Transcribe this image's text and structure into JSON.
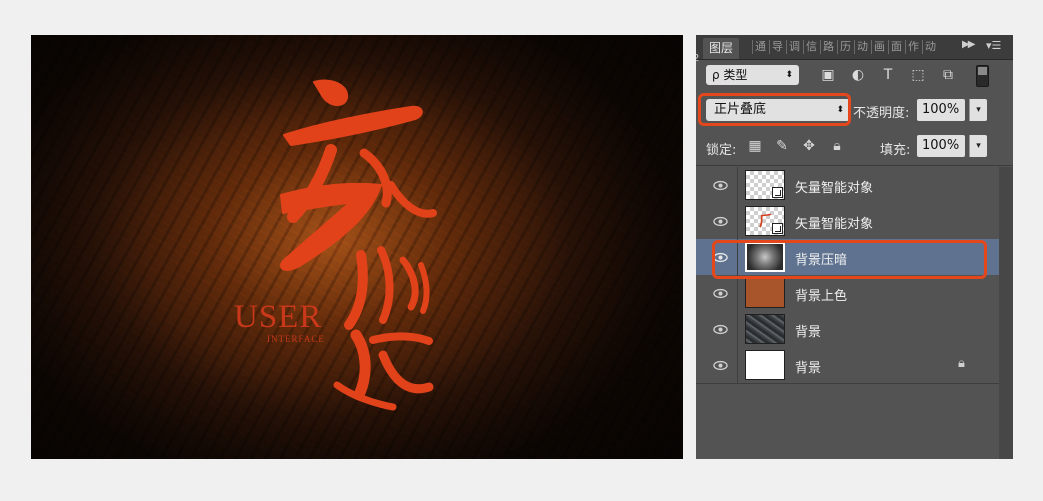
{
  "artwork": {
    "brand_text": "USER",
    "sub_text": "INTERFACE"
  },
  "layers_panel": {
    "tabs": [
      "图层",
      "通",
      "导",
      "调",
      "信",
      "路",
      "历",
      "动",
      "画",
      "面",
      "作",
      "动"
    ],
    "side_number": "2",
    "filter": {
      "label": "ρ 类型"
    },
    "blend_mode": "正片叠底",
    "opacity": {
      "label": "不透明度:",
      "value": "100%"
    },
    "lock": {
      "label": "锁定:"
    },
    "fill": {
      "label": "填充:",
      "value": "100%"
    },
    "layers": [
      {
        "name": "矢量智能对象",
        "thumb": "checker-smart",
        "visible": true,
        "selected": false
      },
      {
        "name": "矢量智能对象",
        "thumb": "checker-smart-mark",
        "visible": true,
        "selected": false
      },
      {
        "name": "背景压暗",
        "thumb": "dark-radial",
        "visible": true,
        "selected": true
      },
      {
        "name": "背景上色",
        "thumb": "brown",
        "visible": true,
        "selected": false
      },
      {
        "name": "背景",
        "thumb": "rock",
        "visible": true,
        "selected": false
      },
      {
        "name": "背景",
        "thumb": "white",
        "visible": true,
        "selected": false,
        "locked": true
      }
    ],
    "colors": {
      "highlight": "#e4471c",
      "selected_row": "#5f7391",
      "panel_bg": "#535353"
    }
  }
}
